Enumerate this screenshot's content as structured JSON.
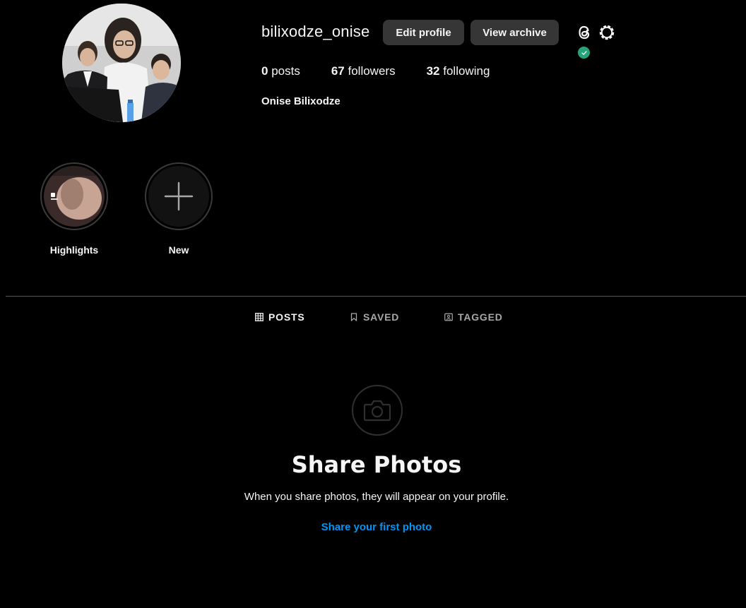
{
  "profile": {
    "username": "bilixodze_onise",
    "full_name": "Onise Bilixodze",
    "avatar_icon": "profile-photo",
    "edit_label": "Edit profile",
    "archive_label": "View archive",
    "threads_icon": "threads-icon",
    "settings_icon": "settings-gear-icon",
    "verified_color": "#27a37a"
  },
  "stats": {
    "posts_count": "0",
    "posts_label": "posts",
    "followers_count": "67",
    "followers_label": "followers",
    "following_count": "32",
    "following_label": "following"
  },
  "highlights": [
    {
      "label": "Highlights",
      "icon": "highlight-cover-image"
    },
    {
      "label": "New",
      "icon": "plus-icon"
    }
  ],
  "tabs": [
    {
      "label": "POSTS",
      "icon": "grid-icon",
      "active": true
    },
    {
      "label": "SAVED",
      "icon": "bookmark-icon",
      "active": false
    },
    {
      "label": "TAGGED",
      "icon": "tagged-user-icon",
      "active": false
    }
  ],
  "empty_state": {
    "icon": "camera-icon",
    "title": "Share Photos",
    "subtitle": "When you share photos, they will appear on your profile.",
    "link": "Share your first photo"
  },
  "colors": {
    "background": "#000000",
    "button": "#363636",
    "link": "#0095f6",
    "muted_text": "#a8a8a8"
  }
}
